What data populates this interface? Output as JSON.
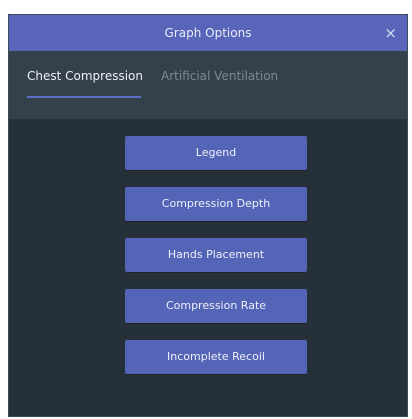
{
  "dialog": {
    "title": "Graph Options",
    "close_glyph": "×",
    "close_icon": "close-icon"
  },
  "tabs": [
    {
      "label": "Chest Compression",
      "active": true
    },
    {
      "label": "Artificial Ventilation",
      "active": false
    }
  ],
  "buttons": [
    {
      "label": "Legend"
    },
    {
      "label": "Compression Depth"
    },
    {
      "label": "Hands Placement"
    },
    {
      "label": "Compression Rate"
    },
    {
      "label": "Incomplete Recoil"
    }
  ],
  "colors": {
    "title_bar": "#5865b8",
    "tab_bar": "#34414b",
    "panel": "#263038",
    "button": "#5464b6",
    "active_underline": "#5b6fc6"
  }
}
